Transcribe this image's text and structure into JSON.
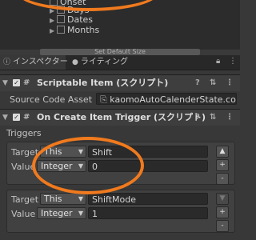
{
  "hierarchy": {
    "items": [
      {
        "label": "Onset",
        "has_arrow": false
      },
      {
        "label": "Days",
        "has_arrow": true
      },
      {
        "label": "Dates",
        "has_arrow": true
      },
      {
        "label": "Months",
        "has_arrow": true
      }
    ],
    "default_size_button": "Set Default Size"
  },
  "tabs": {
    "inspector": "インスペクター",
    "lighting": "ライティング"
  },
  "scriptable_item": {
    "title": "Scriptable Item (スクリプト)",
    "source_label": "Source Code Asset",
    "source_value": "kaomoAutoCalenderState.con"
  },
  "trigger_component": {
    "title": "On Create Item Trigger (スクリプト)",
    "triggers_label": "Triggers",
    "groups": [
      {
        "target_label": "Target",
        "target_value": "This",
        "target_text": "Shift",
        "value_label": "Value",
        "value_type": "Integer",
        "value_amount": "0"
      },
      {
        "target_label": "Target",
        "target_value": "This",
        "target_text": "ShiftMode",
        "value_label": "Value",
        "value_type": "Integer",
        "value_amount": "1"
      }
    ],
    "add_button": "+",
    "remove_button": "-",
    "up_button": "▲",
    "down_button": "▼"
  },
  "colors": {
    "annotation": "#f07a1e"
  }
}
